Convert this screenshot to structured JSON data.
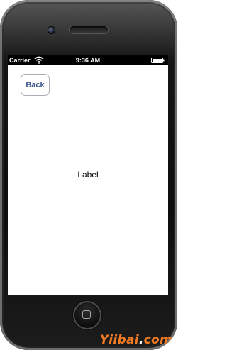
{
  "status_bar": {
    "carrier": "Carrier",
    "time": "9:36 AM",
    "wifi_icon": "wifi-icon",
    "battery_icon": "battery-icon"
  },
  "navigation": {
    "back_label": "Back"
  },
  "content": {
    "label_text": "Label"
  },
  "device": {
    "camera_icon": "camera-icon",
    "home_button_icon": "home-button-icon"
  },
  "watermark": {
    "brand": "Yiibai",
    "separator": ".",
    "suffix": "com"
  },
  "colors": {
    "back_text": "#385487",
    "watermark": "#f17a22",
    "status_bar_bg": "#000000"
  }
}
